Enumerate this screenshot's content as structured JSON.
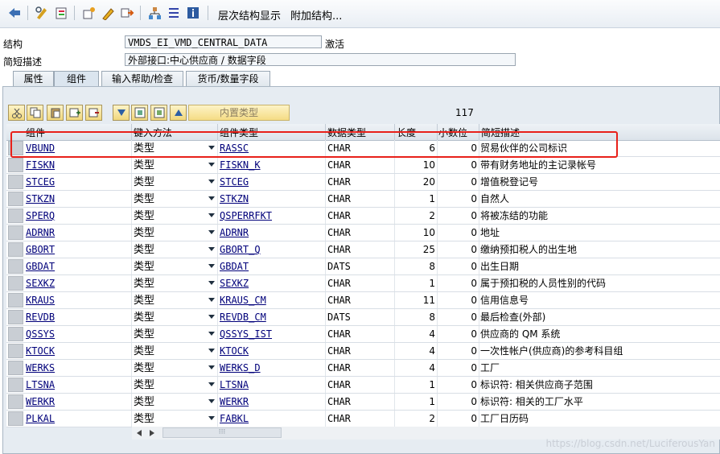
{
  "toolbar": {
    "hierarchy_label": "层次结构显示",
    "append_label": "附加结构..."
  },
  "form": {
    "structure_label": "结构",
    "structure_value": "VMDS_EI_VMD_CENTRAL_DATA",
    "status": "激活",
    "desc_label": "简短描述",
    "desc_value": "外部接口:中心供应商 / 数据字段"
  },
  "tabs": [
    "属性",
    "组件",
    "输入帮助/检查",
    "货币/数量字段"
  ],
  "grid_toolbar": {
    "builtin_type_label": "内置类型",
    "count": "117"
  },
  "columns": [
    "组件",
    "键入方法",
    "组件类型",
    "数据类型",
    "长度",
    "小数位",
    "简短描述"
  ],
  "rows": [
    {
      "component": "VBUND",
      "method": "类型",
      "ctype": "RASSC",
      "dtype": "CHAR",
      "len": "6",
      "dec": "0",
      "desc": "贸易伙伴的公司标识"
    },
    {
      "component": "FISKN",
      "method": "类型",
      "ctype": "FISKN_K",
      "dtype": "CHAR",
      "len": "10",
      "dec": "0",
      "desc": "带有财务地址的主记录帐号"
    },
    {
      "component": "STCEG",
      "method": "类型",
      "ctype": "STCEG",
      "dtype": "CHAR",
      "len": "20",
      "dec": "0",
      "desc": "增值税登记号"
    },
    {
      "component": "STKZN",
      "method": "类型",
      "ctype": "STKZN",
      "dtype": "CHAR",
      "len": "1",
      "dec": "0",
      "desc": "自然人"
    },
    {
      "component": "SPERQ",
      "method": "类型",
      "ctype": "QSPERRFKT",
      "dtype": "CHAR",
      "len": "2",
      "dec": "0",
      "desc": "将被冻结的功能"
    },
    {
      "component": "ADRNR",
      "method": "类型",
      "ctype": "ADRNR",
      "dtype": "CHAR",
      "len": "10",
      "dec": "0",
      "desc": "地址"
    },
    {
      "component": "GBORT",
      "method": "类型",
      "ctype": "GBORT_Q",
      "dtype": "CHAR",
      "len": "25",
      "dec": "0",
      "desc": "缴纳预扣税人的出生地"
    },
    {
      "component": "GBDAT",
      "method": "类型",
      "ctype": "GBDAT",
      "dtype": "DATS",
      "len": "8",
      "dec": "0",
      "desc": "出生日期"
    },
    {
      "component": "SEXKZ",
      "method": "类型",
      "ctype": "SEXKZ",
      "dtype": "CHAR",
      "len": "1",
      "dec": "0",
      "desc": "属于预扣税的人员性别的代码"
    },
    {
      "component": "KRAUS",
      "method": "类型",
      "ctype": "KRAUS_CM",
      "dtype": "CHAR",
      "len": "11",
      "dec": "0",
      "desc": "信用信息号"
    },
    {
      "component": "REVDB",
      "method": "类型",
      "ctype": "REVDB_CM",
      "dtype": "DATS",
      "len": "8",
      "dec": "0",
      "desc": "最后检查(外部)"
    },
    {
      "component": "QSSYS",
      "method": "类型",
      "ctype": "QSSYS_IST",
      "dtype": "CHAR",
      "len": "4",
      "dec": "0",
      "desc": "供应商的 QM 系统"
    },
    {
      "component": "KTOCK",
      "method": "类型",
      "ctype": "KTOCK",
      "dtype": "CHAR",
      "len": "4",
      "dec": "0",
      "desc": "一次性帐户(供应商)的参考科目组"
    },
    {
      "component": "WERKS",
      "method": "类型",
      "ctype": "WERKS_D",
      "dtype": "CHAR",
      "len": "4",
      "dec": "0",
      "desc": "工厂"
    },
    {
      "component": "LTSNA",
      "method": "类型",
      "ctype": "LTSNA",
      "dtype": "CHAR",
      "len": "1",
      "dec": "0",
      "desc": "标识符: 相关供应商子范围"
    },
    {
      "component": "WERKR",
      "method": "类型",
      "ctype": "WERKR",
      "dtype": "CHAR",
      "len": "1",
      "dec": "0",
      "desc": "标识符: 相关的工厂水平"
    },
    {
      "component": "PLKAL",
      "method": "类型",
      "ctype": "FABKL",
      "dtype": "CHAR",
      "len": "2",
      "dec": "0",
      "desc": "工厂日历码"
    }
  ],
  "scroll": {
    "handle_label": "⁝⁝⁝"
  },
  "watermark": "https://blog.csdn.net/LuciferousYan",
  "colors": {
    "highlight_box": "#e8201a",
    "link": "#00007a"
  }
}
